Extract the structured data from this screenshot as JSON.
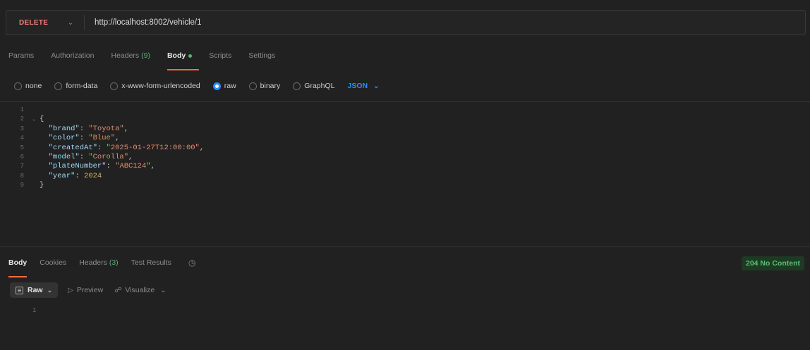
{
  "request": {
    "method": "DELETE",
    "url": "http://localhost:8002/vehicle/1"
  },
  "request_tabs": [
    {
      "label": "Params"
    },
    {
      "label": "Authorization"
    },
    {
      "label": "Headers",
      "count": "(9)"
    },
    {
      "label": "Body",
      "active": true
    },
    {
      "label": "Scripts"
    },
    {
      "label": "Settings"
    }
  ],
  "body_types": {
    "options": [
      "none",
      "form-data",
      "x-www-form-urlencoded",
      "raw",
      "binary",
      "GraphQL"
    ],
    "selected": "raw",
    "format": "JSON"
  },
  "editor": {
    "lines": [
      {
        "n": "1",
        "code": ""
      },
      {
        "n": "2",
        "code": "{"
      },
      {
        "n": "3",
        "key": "\"brand\"",
        "value": "\"Toyota\"",
        "type": "string",
        "comma": true
      },
      {
        "n": "4",
        "key": "\"color\"",
        "value": "\"Blue\"",
        "type": "string",
        "comma": true
      },
      {
        "n": "5",
        "key": "\"createdAt\"",
        "value": "\"2025-01-27T12:00:00\"",
        "type": "string",
        "comma": true
      },
      {
        "n": "6",
        "key": "\"model\"",
        "value": "\"Corolla\"",
        "type": "string",
        "comma": true
      },
      {
        "n": "7",
        "key": "\"plateNumber\"",
        "value": "\"ABC124\"",
        "type": "string",
        "comma": true
      },
      {
        "n": "8",
        "key": "\"year\"",
        "value": "2024",
        "type": "number",
        "comma": false
      },
      {
        "n": "9",
        "code": "}"
      }
    ]
  },
  "response": {
    "tabs": {
      "body": "Body",
      "cookies": "Cookies",
      "headers": "Headers",
      "headers_count": "(3)",
      "test_results": "Test Results"
    },
    "status": "204 No Content",
    "view": {
      "raw": "Raw",
      "preview": "Preview",
      "visualize": "Visualize"
    },
    "line_number": "1"
  },
  "colors": {
    "method": "#f08070",
    "accent": "#ff6c37",
    "selected_radio": "#2e8bff",
    "status_ok": "#57c26c"
  }
}
